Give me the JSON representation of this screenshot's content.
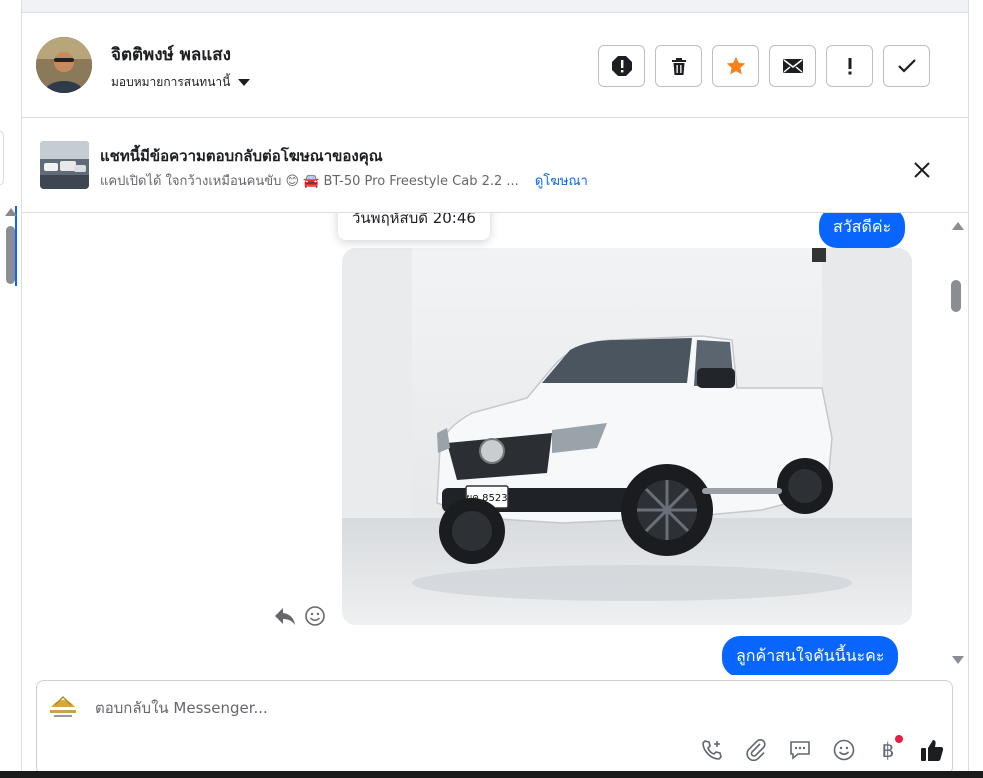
{
  "header": {
    "contact_name": "จิตติพงษ์ พลแสง",
    "assign_label": "มอบหมายการสนทนานี้",
    "actions": [
      {
        "icon": "alert-circle-icon",
        "name": "mark-spam-button"
      },
      {
        "icon": "trash-icon",
        "name": "delete-button"
      },
      {
        "icon": "star-icon",
        "name": "star-button",
        "color": "#f7811b"
      },
      {
        "icon": "envelope-icon",
        "name": "mark-unread-button"
      },
      {
        "icon": "exclamation-icon",
        "name": "follow-up-button"
      },
      {
        "icon": "check-icon",
        "name": "mark-done-button"
      }
    ]
  },
  "ad_banner": {
    "title": "แชทนี้มีข้อความตอบกลับต่อโฆษณาของคุณ",
    "subtitle": "แคปเปิดได้ ใจกว้างเหมือนคนขับ 😊 🚘 BT-50 Pro Freestyle Cab 2.2 ...",
    "link": "ดูโฆษณา"
  },
  "thread": {
    "tooltip": "วันพฤหัสบดี 20:46",
    "messages": [
      {
        "text": "สวัสดีค่ะ"
      },
      {
        "text": "ลูกค้าสนใจคันนี้นะคะ"
      }
    ],
    "photo": {
      "plate": "ผค 8523"
    }
  },
  "composer": {
    "placeholder": "ตอบกลับใน Messenger...",
    "baht": "฿"
  },
  "colors": {
    "accent": "#0866ff",
    "star": "#f7811b",
    "badge": "#e41e3f"
  }
}
